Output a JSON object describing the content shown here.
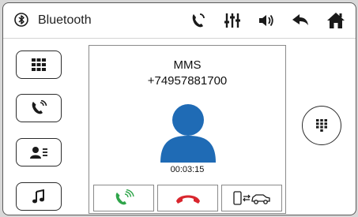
{
  "header": {
    "title": "Bluetooth",
    "icons": [
      "bluetooth-icon",
      "call-log-icon",
      "equalizer-icon",
      "volume-icon",
      "back-icon",
      "home-icon"
    ]
  },
  "sidebar": {
    "items": [
      {
        "name": "keypad",
        "icon": "grid-icon"
      },
      {
        "name": "calls",
        "icon": "phone-icon"
      },
      {
        "name": "contacts",
        "icon": "contact-card-icon"
      },
      {
        "name": "music",
        "icon": "music-note-icon"
      }
    ]
  },
  "call": {
    "caller_name": "MMS",
    "caller_number": "+74957881700",
    "duration": "00:03:15",
    "buttons": [
      "answer",
      "hang-up",
      "transfer-to-phone"
    ]
  },
  "colors": {
    "accent_blue": "#1f6bb5",
    "answer_green": "#2fa54a",
    "hangup_red": "#d9262e",
    "icon_dark": "#1a1a1a"
  }
}
